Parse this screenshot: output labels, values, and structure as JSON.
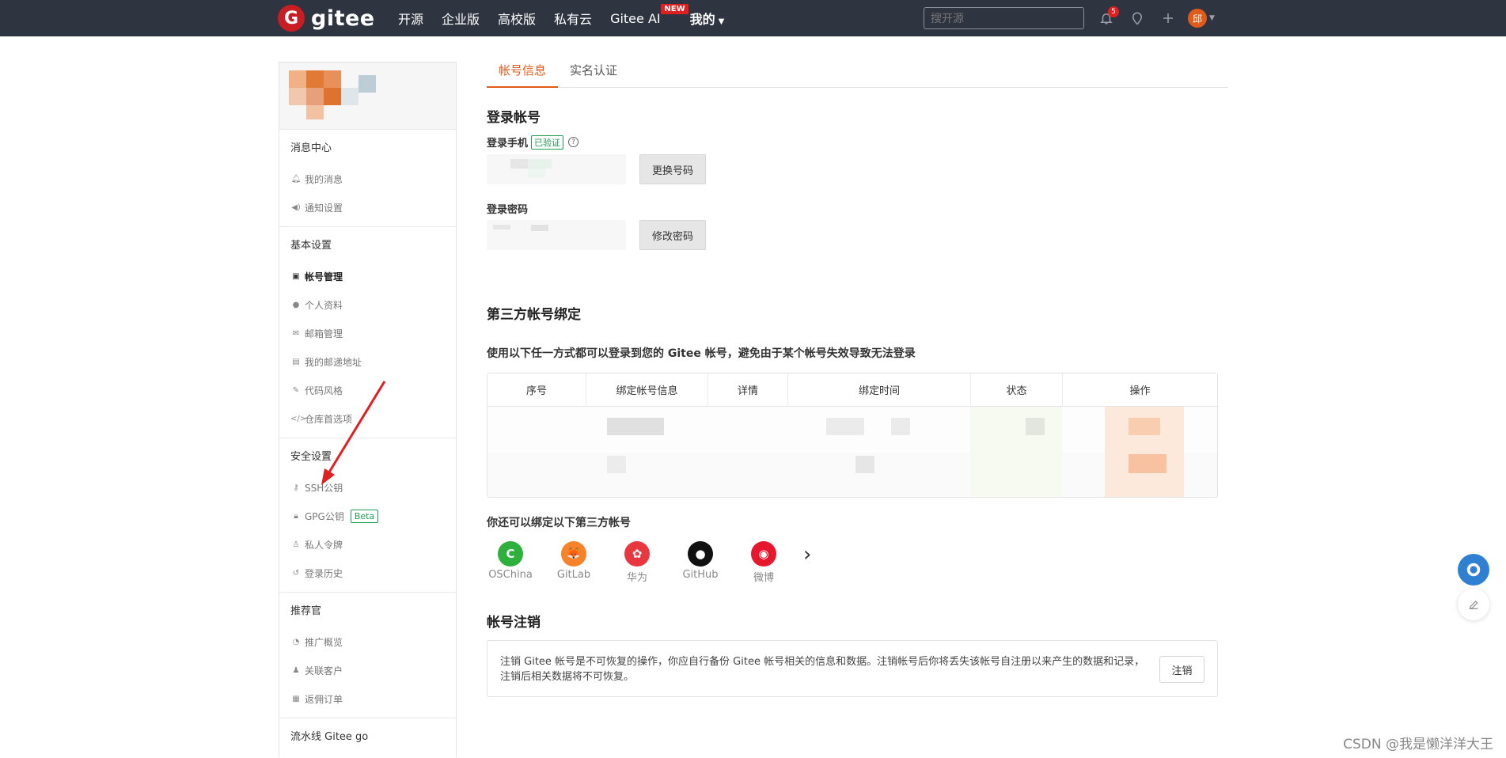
{
  "nav": {
    "logo_text": "gitee",
    "logo_mark": "G",
    "links": [
      {
        "label": "开源"
      },
      {
        "label": "企业版"
      },
      {
        "label": "高校版"
      },
      {
        "label": "私有云"
      },
      {
        "label": "Gitee AI",
        "badge": "NEW"
      }
    ],
    "mine_label": "我的",
    "search_placeholder": "搜开源",
    "notification_count": "5",
    "avatar_initial": "邱"
  },
  "sidebar": {
    "sections": [
      {
        "title": "消息中心",
        "items": [
          {
            "label": "我的消息",
            "icon": "bell-icon"
          },
          {
            "label": "通知设置",
            "icon": "volume-icon"
          }
        ]
      },
      {
        "title": "基本设置",
        "items": [
          {
            "label": "帐号管理",
            "icon": "id-card-icon",
            "active": true
          },
          {
            "label": "个人资料",
            "icon": "user-icon"
          },
          {
            "label": "邮箱管理",
            "icon": "mail-icon"
          },
          {
            "label": "我的邮递地址",
            "icon": "address-card-icon"
          },
          {
            "label": "代码风格",
            "icon": "brush-icon"
          },
          {
            "label": "仓库首选项",
            "icon": "code-icon"
          }
        ]
      },
      {
        "title": "安全设置",
        "items": [
          {
            "label": "SSH公钥",
            "icon": "key-icon"
          },
          {
            "label": "GPG公钥",
            "icon": "lock-icon",
            "badge": "Beta"
          },
          {
            "label": "私人令牌",
            "icon": "token-icon"
          },
          {
            "label": "登录历史",
            "icon": "history-icon"
          }
        ]
      },
      {
        "title": "推荐官",
        "items": [
          {
            "label": "推广概览",
            "icon": "chart-icon"
          },
          {
            "label": "关联客户",
            "icon": "user-link-icon"
          },
          {
            "label": "返佣订单",
            "icon": "order-icon"
          }
        ]
      },
      {
        "title": "流水线 Gitee go",
        "items": []
      }
    ]
  },
  "main": {
    "tabs": [
      {
        "label": "帐号信息",
        "active": true
      },
      {
        "label": "实名认证"
      }
    ],
    "login": {
      "title": "登录帐号",
      "phone_label": "登录手机",
      "verified_badge": "已验证",
      "help_glyph": "?",
      "change_phone_button": "更换号码",
      "password_label": "登录密码",
      "change_password_button": "修改密码"
    },
    "third_party": {
      "title": "第三方帐号绑定",
      "description": "使用以下任一方式都可以登录到您的 Gitee 帐号，避免由于某个帐号失效导致无法登录",
      "columns": [
        "序号",
        "绑定帐号信息",
        "详情",
        "绑定时间",
        "状态",
        "操作"
      ],
      "more_title": "你还可以绑定以下第三方帐号",
      "providers": [
        {
          "name": "OSChina",
          "icon": "oschina-icon",
          "color": "#2eb13c",
          "glyph": "C"
        },
        {
          "name": "GitLab",
          "icon": "gitlab-icon",
          "color": "#f6832a",
          "glyph": "🦊"
        },
        {
          "name": "华为",
          "icon": "huawei-icon",
          "color": "#e8373e",
          "glyph": "✿"
        },
        {
          "name": "GitHub",
          "icon": "github-icon",
          "color": "#111111",
          "glyph": "●"
        },
        {
          "name": "微博",
          "icon": "weibo-icon",
          "color": "#e6162d",
          "glyph": "◉"
        }
      ],
      "next_glyph": "›"
    },
    "cancel": {
      "title": "帐号注销",
      "text": "注销 Gitee 帐号是不可恢复的操作，你应自行备份 Gitee 帐号相关的信息和数据。注销帐号后你将丢失该帐号自注册以来产生的数据和记录，注销后相关数据将不可恢复。",
      "button": "注销"
    }
  },
  "watermark": "CSDN @我是懒洋洋大王",
  "colors": {
    "nav_bg": "#2e3440",
    "accent": "#e05a1a",
    "green": "#1f9d55"
  }
}
